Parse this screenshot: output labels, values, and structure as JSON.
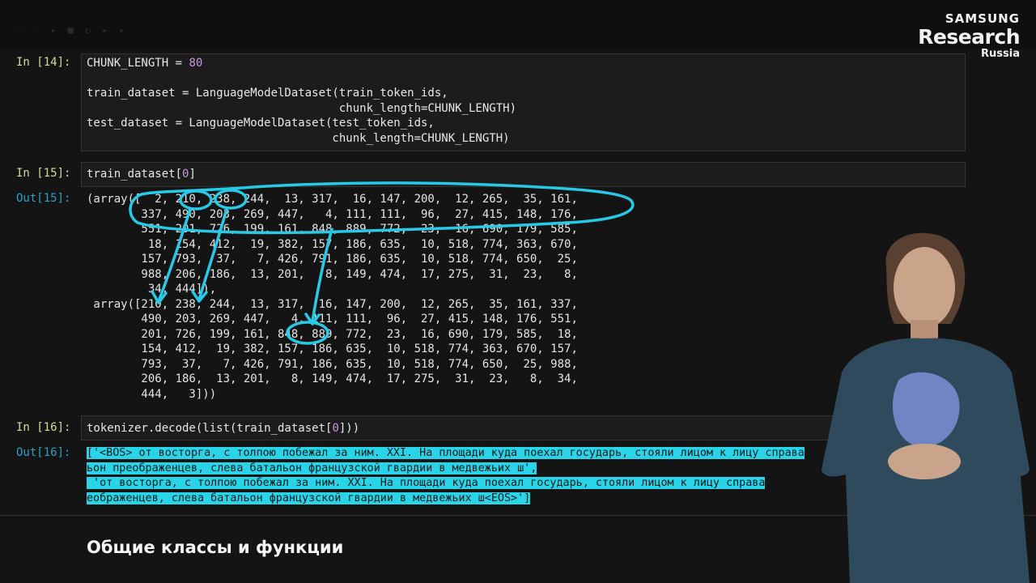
{
  "branding": {
    "line1": "SAMSUNG",
    "line2": "Research",
    "line3": "Russia"
  },
  "cells": {
    "c14": {
      "prompt": "In [14]:",
      "l1_a": "CHUNK_LENGTH = ",
      "l1_b": "80",
      "l2": "train_dataset = LanguageModelDataset(train_token_ids,",
      "l3": "                                     chunk_length=CHUNK_LENGTH)",
      "l4": "test_dataset = LanguageModelDataset(test_token_ids,",
      "l5": "                                    chunk_length=CHUNK_LENGTH)"
    },
    "c15": {
      "prompt": "In [15]:",
      "code_a": "train_dataset[",
      "code_b": "0",
      "code_c": "]",
      "out_prompt": "Out[15]:",
      "output": "(array([  2, 210, 238, 244,  13, 317,  16, 147, 200,  12, 265,  35, 161,\n        337, 490, 203, 269, 447,   4, 111, 111,  96,  27, 415, 148, 176,\n        551, 201, 726, 199, 161, 848, 889, 772,  23,  16, 690, 179, 585,\n         18, 154, 412,  19, 382, 157, 186, 635,  10, 518, 774, 363, 670,\n        157, 793,  37,   7, 426, 791, 186, 635,  10, 518, 774, 650,  25,\n        988, 206, 186,  13, 201,   8, 149, 474,  17, 275,  31,  23,   8,\n         34, 444]),\n array([210, 238, 244,  13, 317,  16, 147, 200,  12, 265,  35, 161, 337,\n        490, 203, 269, 447,   4, 111, 111,  96,  27, 415, 148, 176, 551,\n        201, 726, 199, 161, 848, 889, 772,  23,  16, 690, 179, 585,  18,\n        154, 412,  19, 382, 157, 186, 635,  10, 518, 774, 363, 670, 157,\n        793,  37,   7, 426, 791, 186, 635,  10, 518, 774, 650,  25, 988,\n        206, 186,  13, 201,   8, 149, 474,  17, 275,  31,  23,   8,  34,\n        444,   3]))"
    },
    "c16": {
      "prompt": "In [16]:",
      "code_a": "tokenizer.decode(list(train_dataset[",
      "code_b": "0",
      "code_c": "]))",
      "out_prompt": "Out[16]:",
      "line1": "['<BOS> от восторга, с толпою побежал за ним. XXI. На площади куда поехал государь, стояли лицом к лицу справа",
      "line2": "ьон преображенцев, слева батальон французской гвардии в медвежьих ш',",
      "line3": " 'от восторга, с толпою побежал за ним. XXI. На площади куда поехал государь, стояли лицом к лицу справа",
      "line4": "еображенцев, слева батальон французской гвардии в медвежьих ш<EOS>']"
    }
  },
  "section_heading": "Общие классы и функции",
  "colors": {
    "prompt_in": "#d8d8a0",
    "prompt_out": "#2ea0c6",
    "number": "#c899d8",
    "selection": "#2ad4e8",
    "annotation": "#27c9e6"
  }
}
